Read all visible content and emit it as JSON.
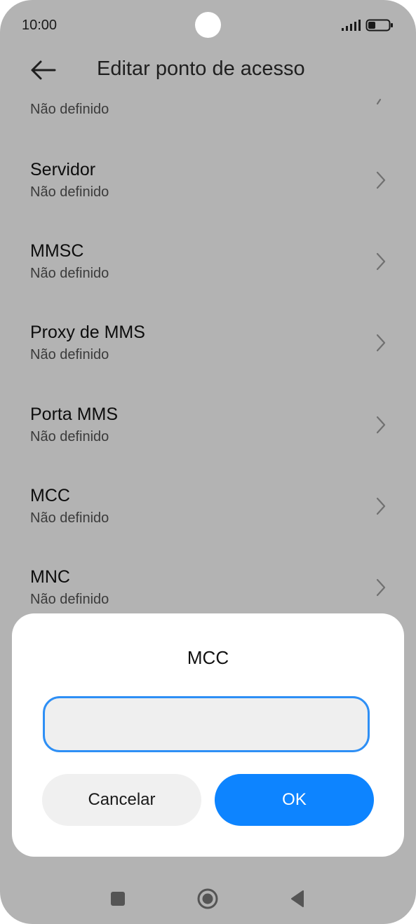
{
  "status_bar": {
    "time": "10:00",
    "signal_icon": "signal-bars-icon",
    "battery_icon": "battery-icon"
  },
  "header": {
    "back_icon": "arrow-left-icon",
    "title": "Editar ponto de acesso"
  },
  "partial_item": {
    "sub": "Não definido"
  },
  "items": [
    {
      "label": "Servidor",
      "sub": "Não definido"
    },
    {
      "label": "MMSC",
      "sub": "Não definido"
    },
    {
      "label": "Proxy de MMS",
      "sub": "Não definido"
    },
    {
      "label": "Porta MMS",
      "sub": "Não definido"
    },
    {
      "label": "MCC",
      "sub": "Não definido"
    },
    {
      "label": "MNC",
      "sub": "Não definido"
    }
  ],
  "dialog": {
    "title": "MCC",
    "input_value": "",
    "input_placeholder": "",
    "cancel_label": "Cancelar",
    "ok_label": "OK"
  },
  "nav": {
    "recent_icon": "square-icon",
    "home_icon": "circle-home-icon",
    "back_icon": "triangle-back-icon"
  },
  "colors": {
    "dim_background": "#b3b3b3",
    "accent": "#0d84ff",
    "input_border": "#2e8ff5"
  }
}
